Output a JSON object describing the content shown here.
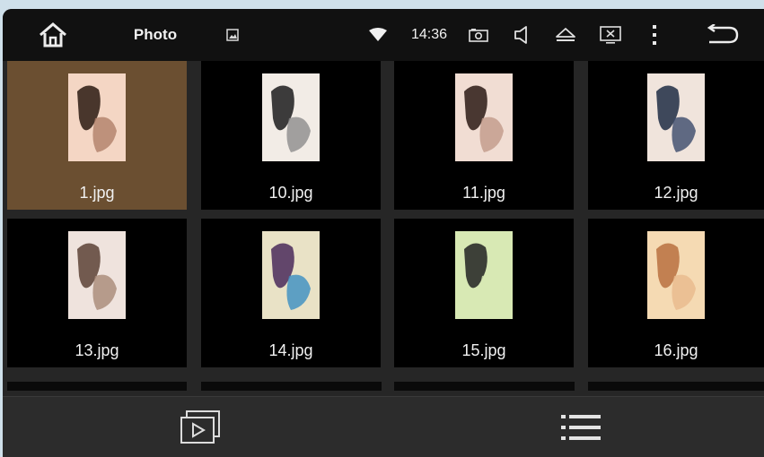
{
  "header": {
    "title": "Photo",
    "clock": "14:36"
  },
  "icons": {
    "home": "home-icon",
    "gallery": "image-icon",
    "wifi": "wifi-icon",
    "screenshot": "camera-icon",
    "volume": "volume-icon",
    "eject": "eject-icon",
    "display_off": "screen-off-icon",
    "menu": "more-vertical-icon",
    "back": "back-icon",
    "slideshow": "slideshow-icon",
    "list": "list-icon"
  },
  "files": [
    {
      "name": "1.jpg",
      "selected": true,
      "palette": [
        "#f4d6c4",
        "#2a1a12",
        "#b07f69"
      ]
    },
    {
      "name": "10.jpg",
      "selected": false,
      "palette": [
        "#f2ece6",
        "#1c1c1c",
        "#8c8c8c"
      ]
    },
    {
      "name": "11.jpg",
      "selected": false,
      "palette": [
        "#f1ddd3",
        "#2b1a14",
        "#c29a8a"
      ]
    },
    {
      "name": "12.jpg",
      "selected": false,
      "palette": [
        "#f0e4dc",
        "#1f2d44",
        "#3b4a6b"
      ]
    },
    {
      "name": "13.jpg",
      "selected": false,
      "palette": [
        "#efe3dd",
        "#5c4236",
        "#a88877"
      ]
    },
    {
      "name": "14.jpg",
      "selected": false,
      "palette": [
        "#e9e2c6",
        "#4a2a5a",
        "#3a8fc2"
      ]
    },
    {
      "name": "15.jpg",
      "selected": false,
      "palette": [
        "#d8e9b4",
        "#222222",
        "#d8e9b4"
      ]
    },
    {
      "name": "16.jpg",
      "selected": false,
      "palette": [
        "#f5dab3",
        "#b9703f",
        "#e8b98c"
      ]
    }
  ],
  "colors": {
    "selected_tile": "#6b4f31",
    "tile": "#000000",
    "bar": "#111111"
  }
}
